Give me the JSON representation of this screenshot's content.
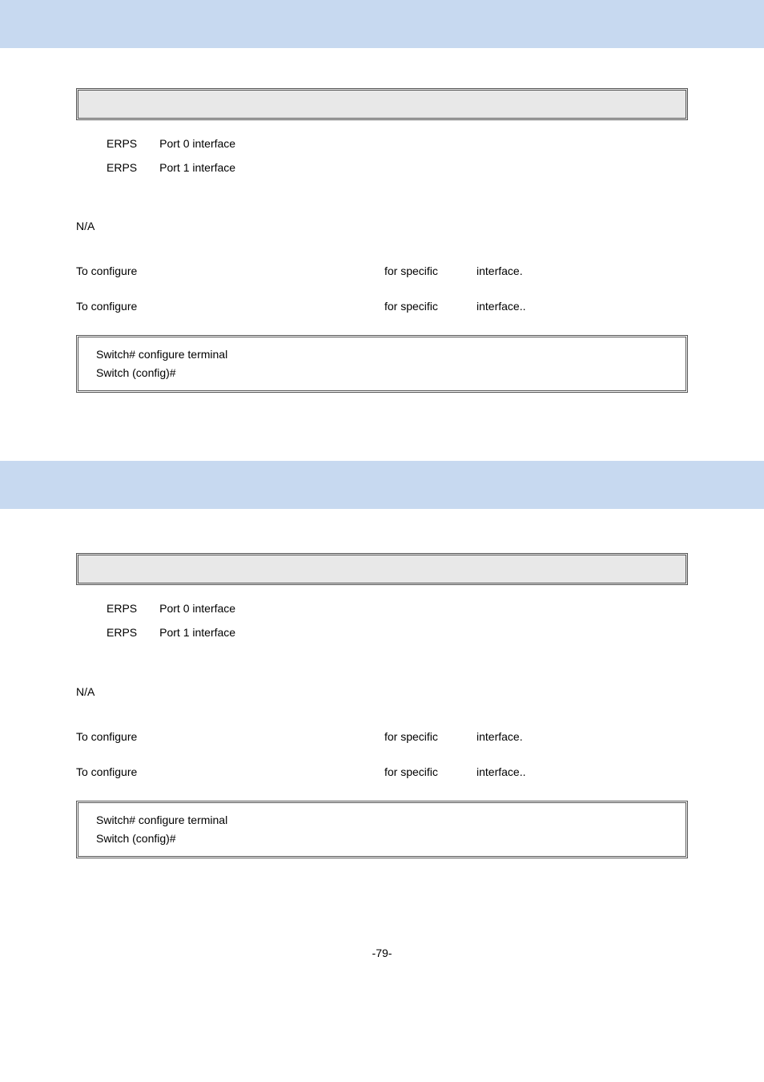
{
  "block1": {
    "params": [
      {
        "a": "ERPS",
        "b": "Port 0 interface"
      },
      {
        "a": "ERPS",
        "b": "Port 1 interface"
      }
    ],
    "default_val": "N/A",
    "usage1": {
      "left": "To configure",
      "mid": "for specific",
      "right": "interface."
    },
    "usage2": {
      "left": "To configure",
      "mid": "for specific",
      "right": "interface.."
    },
    "ex1": "Switch# configure terminal",
    "ex2": "Switch (config)#"
  },
  "block2": {
    "params": [
      {
        "a": "ERPS",
        "b": "Port 0 interface"
      },
      {
        "a": "ERPS",
        "b": "Port 1 interface"
      }
    ],
    "default_val": "N/A",
    "usage1": {
      "left": "To configure",
      "mid": "for specific",
      "right": "interface."
    },
    "usage2": {
      "left": "To configure",
      "mid": "for specific",
      "right": "interface.."
    },
    "ex1": "Switch# configure terminal",
    "ex2": "Switch (config)#"
  },
  "footer": "-79-"
}
